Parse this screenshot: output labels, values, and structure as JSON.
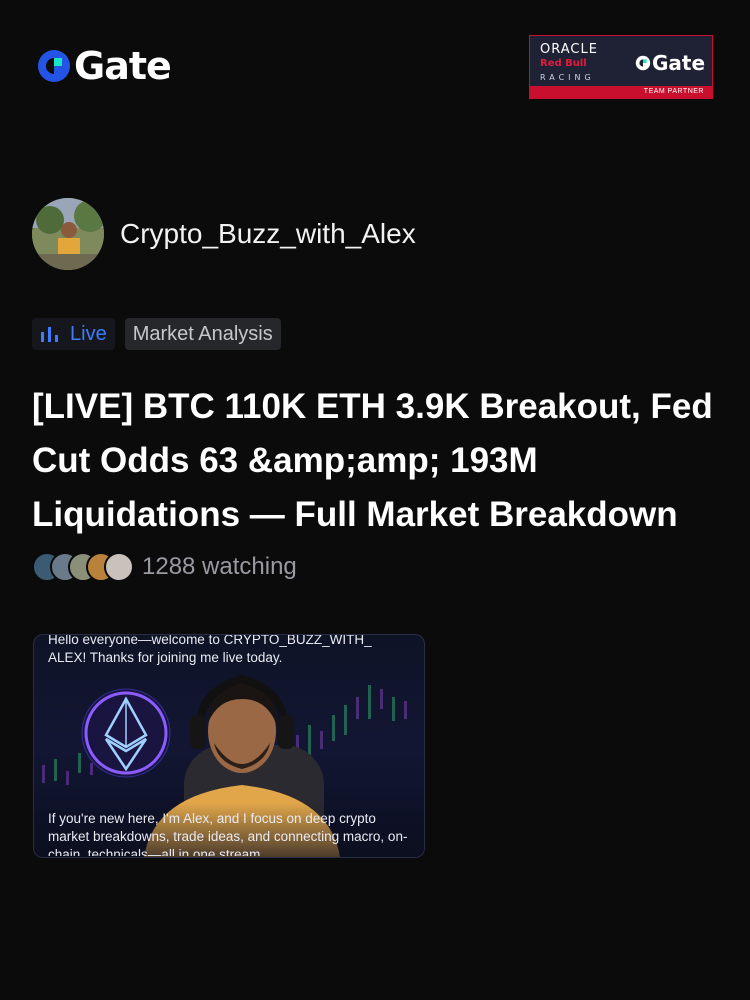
{
  "brand": {
    "name": "Gate",
    "accent": "#2354e6",
    "accent2": "#17e5c4"
  },
  "partner": {
    "oracle": "ORACLE",
    "redbull": "Red Bull",
    "racing": "RACING",
    "gate": "Gate",
    "tag": "TEAM PARTNER"
  },
  "author": {
    "name": "Crypto_Buzz_with_Alex"
  },
  "tags": {
    "live": "Live",
    "category": "Market Analysis"
  },
  "title": "[LIVE] BTC  110K ETH  3.9K Breakout, Fed Cut Odds 63 &amp;amp; 193M Liquidations — Full Market Breakdown",
  "watching": {
    "count_text": "1288 watching"
  },
  "thumbnail": {
    "caption_top": "Hello everyone—welcome to CRYPTO_BUZZ_WITH_ ALEX! Thanks for joining me live today.",
    "caption_bottom": "If you're new here, I'm Alex, and I focus on deep crypto market breakdowns, trade ideas, and connecting macro, on-chain, technicals—all in one stream."
  }
}
